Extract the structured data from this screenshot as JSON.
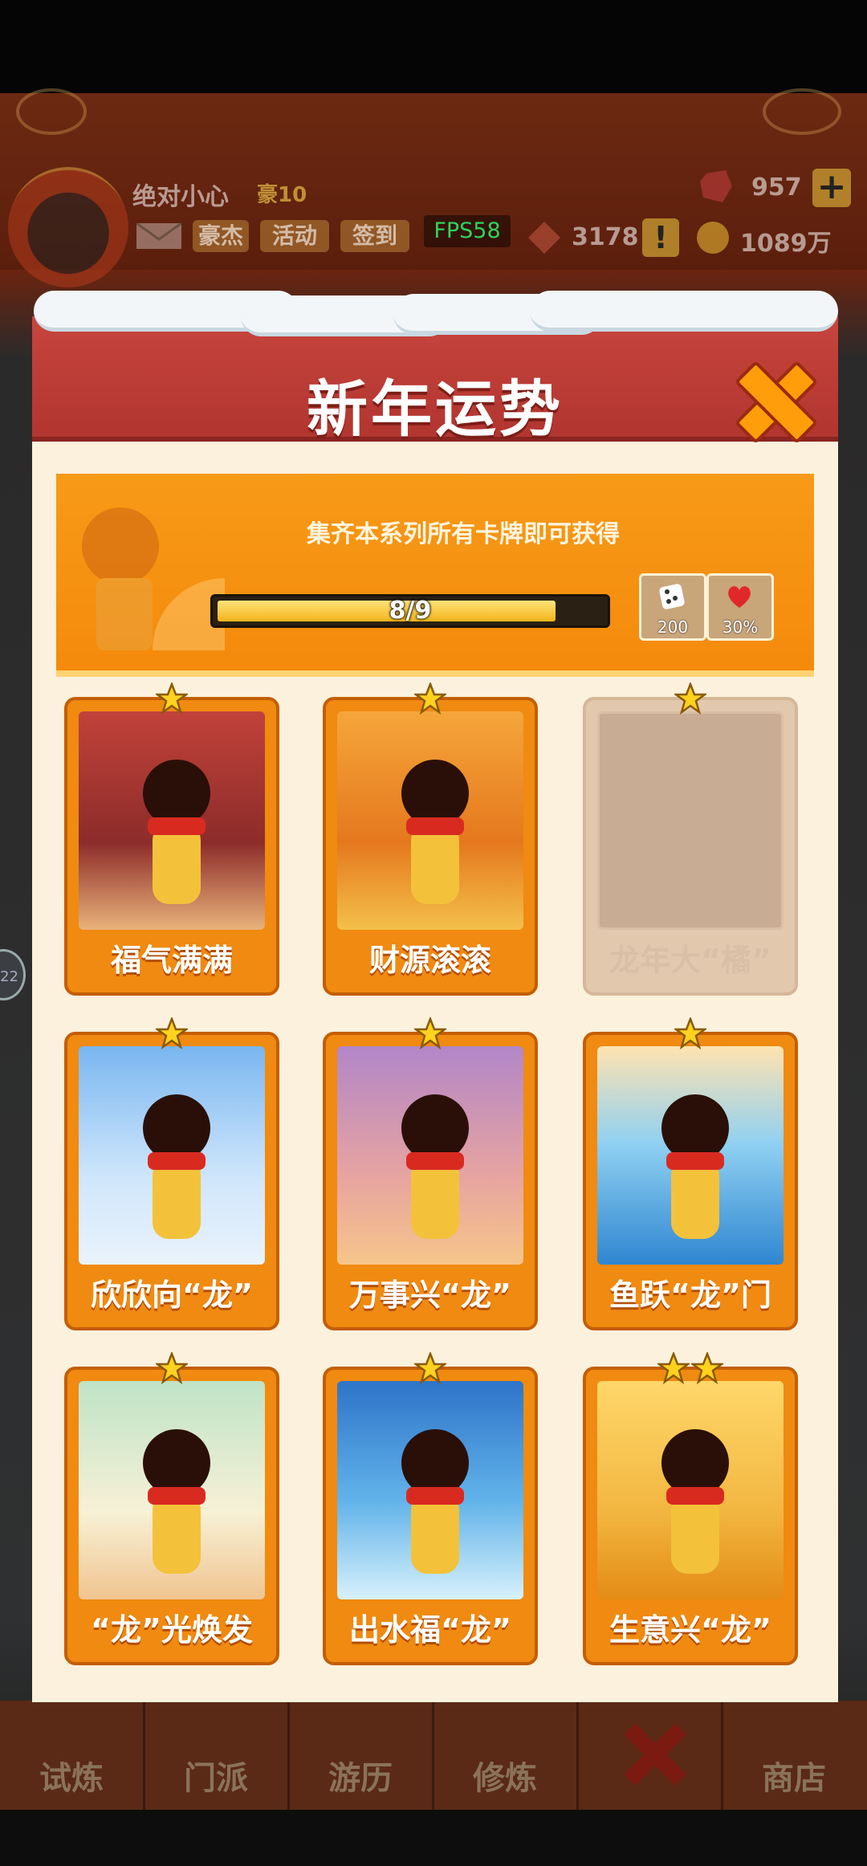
{
  "game": {
    "player_name": "绝对小心",
    "player_rank": "豪10",
    "menu_buttons": [
      "豪杰",
      "活动",
      "签到"
    ],
    "fps": "FPS58",
    "gems": "957",
    "tickets": "3178",
    "gold": "1089万",
    "side_badge": "22",
    "nav_tabs": [
      "试炼",
      "门派",
      "游历",
      "修炼",
      "",
      "商店"
    ]
  },
  "modal": {
    "title": "新年运势",
    "banner_text": "集齐本系列所有卡牌即可获得",
    "progress": {
      "label": "8/9",
      "current": 8,
      "total": 9
    },
    "rewards": [
      {
        "icon": "dice-icon",
        "label": "200"
      },
      {
        "icon": "heart-icon",
        "label": "30%"
      }
    ],
    "cards": [
      {
        "label": "福气满满",
        "stars": 1,
        "collected": true,
        "scene": "sc-red"
      },
      {
        "label": "财源滚滚",
        "stars": 1,
        "collected": true,
        "scene": "sc-gold"
      },
      {
        "label": "龙年大“橘”",
        "stars": 1,
        "collected": false,
        "scene": ""
      },
      {
        "label": "欣欣向“龙”",
        "stars": 1,
        "collected": true,
        "scene": "sc-sky"
      },
      {
        "label": "万事兴“龙”",
        "stars": 1,
        "collected": true,
        "scene": "sc-purple"
      },
      {
        "label": "鱼跃“龙”门",
        "stars": 1,
        "collected": true,
        "scene": "sc-water"
      },
      {
        "label": "“龙”光焕发",
        "stars": 1,
        "collected": true,
        "scene": "sc-green"
      },
      {
        "label": "出水福“龙”",
        "stars": 1,
        "collected": true,
        "scene": "sc-sea"
      },
      {
        "label": "生意兴“龙”",
        "stars": 2,
        "collected": true,
        "scene": "sc-yellow"
      }
    ]
  }
}
